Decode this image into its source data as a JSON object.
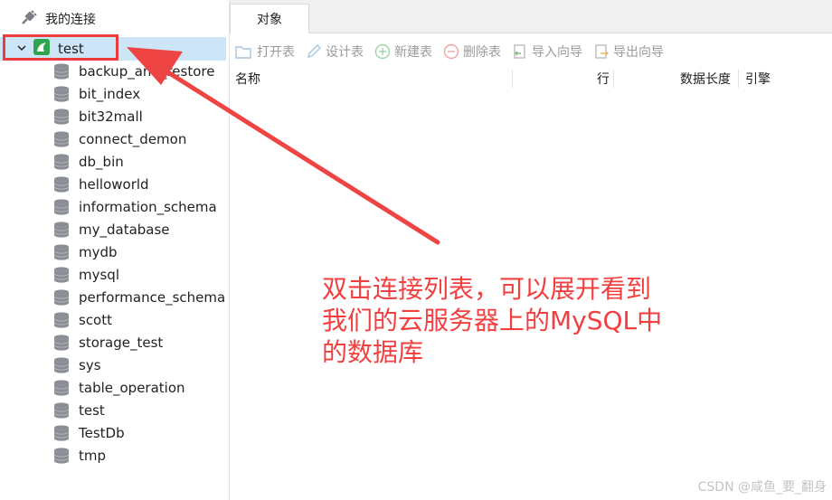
{
  "sidebar": {
    "connection_label": "我的连接",
    "selected_node": "test",
    "databases": [
      "backup_and_restore",
      "bit_index",
      "bit32mall",
      "connect_demon",
      "db_bin",
      "helloworld",
      "information_schema",
      "my_database",
      "mydb",
      "mysql",
      "performance_schema",
      "scott",
      "storage_test",
      "sys",
      "table_operation",
      "test",
      "TestDb",
      "tmp"
    ]
  },
  "tabs": {
    "objects": "对象"
  },
  "toolbar": {
    "open_table": "打开表",
    "design_table": "设计表",
    "new_table": "新建表",
    "delete_table": "删除表",
    "import_wizard": "导入向导",
    "export_wizard": "导出向导"
  },
  "columns": {
    "name": "名称",
    "rows": "行",
    "data_length": "数据长度",
    "engine": "引擎"
  },
  "annotation": {
    "lines": [
      "双击连接列表，可以展开看到",
      "我们的云服务器上的MySQL中",
      "的数据库"
    ],
    "color": "#f24040"
  },
  "watermark": "CSDN @咸鱼_要_翻身",
  "colors": {
    "selection": "#cde6f7",
    "highlight": "#ee3b3b",
    "db_icon": "#8a8f96",
    "test_icon": "#2ea44f"
  }
}
